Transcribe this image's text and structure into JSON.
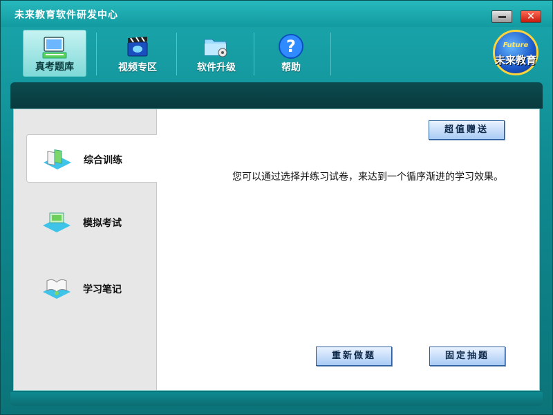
{
  "window": {
    "title": "未来教育软件研发中心",
    "close_glyph": "✕"
  },
  "toolbar": {
    "items": [
      {
        "label": "真考题库",
        "icon": "computer-books-icon",
        "active": true
      },
      {
        "label": "视频专区",
        "icon": "film-clapper-icon",
        "active": false
      },
      {
        "label": "软件升级",
        "icon": "folder-gear-icon",
        "active": false
      },
      {
        "label": "帮助",
        "icon": "help-question-icon",
        "active": false
      }
    ]
  },
  "logo": {
    "en": "Future",
    "cn": "未来教育"
  },
  "sidebar": {
    "items": [
      {
        "label": "综合训练",
        "icon": "books-stack-icon",
        "active": true
      },
      {
        "label": "模拟考试",
        "icon": "laptop-exam-icon",
        "active": false
      },
      {
        "label": "学习笔记",
        "icon": "open-book-icon",
        "active": false
      }
    ]
  },
  "main": {
    "bonus_button": "超值赠送",
    "description": "您可以通过选择并练习试卷，来达到一个循序渐进的学习效果。",
    "redo_button": "重新做题",
    "fixed_button": "固定抽题"
  },
  "colors": {
    "accent": "#129aa0",
    "dark_band": "#0c4b4f",
    "button_border": "#2a5b9a"
  }
}
